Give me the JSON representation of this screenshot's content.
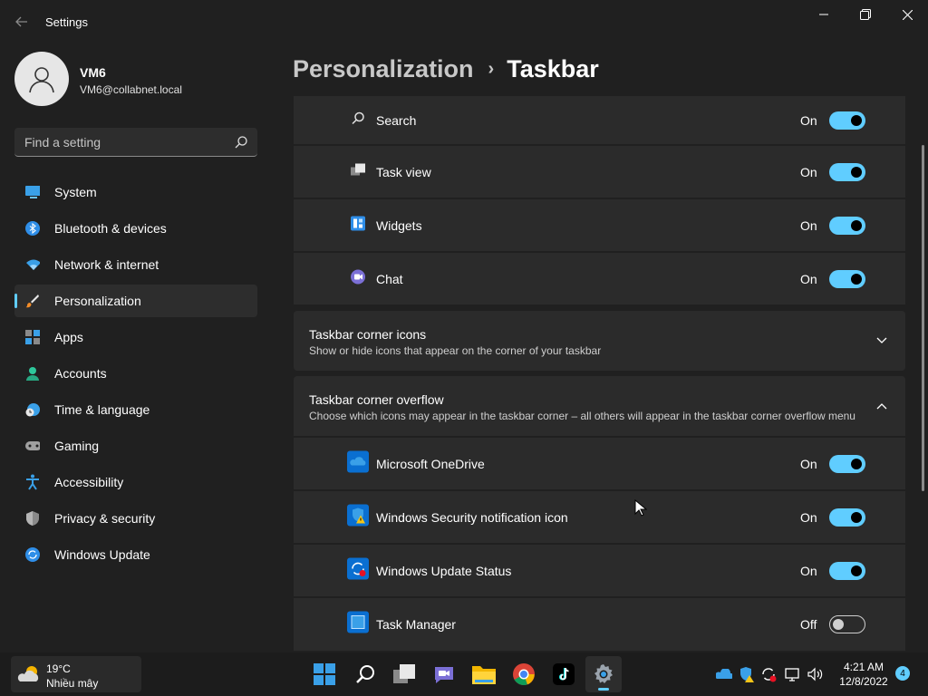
{
  "window": {
    "title": "Settings"
  },
  "user": {
    "name": "VM6",
    "email": "VM6@collabnet.local"
  },
  "search": {
    "placeholder": "Find a setting"
  },
  "sidebar": {
    "items": [
      {
        "label": "System",
        "icon": "monitor-icon"
      },
      {
        "label": "Bluetooth & devices",
        "icon": "bluetooth-icon"
      },
      {
        "label": "Network & internet",
        "icon": "wifi-icon"
      },
      {
        "label": "Personalization",
        "icon": "brush-icon",
        "active": true
      },
      {
        "label": "Apps",
        "icon": "apps-icon"
      },
      {
        "label": "Accounts",
        "icon": "person-icon"
      },
      {
        "label": "Time & language",
        "icon": "clock-globe-icon"
      },
      {
        "label": "Gaming",
        "icon": "gamepad-icon"
      },
      {
        "label": "Accessibility",
        "icon": "accessibility-icon"
      },
      {
        "label": "Privacy & security",
        "icon": "shield-icon"
      },
      {
        "label": "Windows Update",
        "icon": "update-icon"
      }
    ]
  },
  "breadcrumb": {
    "parent": "Personalization",
    "current": "Taskbar"
  },
  "taskbar_items": [
    {
      "label": "Search",
      "state": "On",
      "icon": "search-icon"
    },
    {
      "label": "Task view",
      "state": "On",
      "icon": "task-view-icon"
    },
    {
      "label": "Widgets",
      "state": "On",
      "icon": "widgets-icon"
    },
    {
      "label": "Chat",
      "state": "On",
      "icon": "chat-icon"
    }
  ],
  "corner_icons": {
    "title": "Taskbar corner icons",
    "description": "Show or hide icons that appear on the corner of your taskbar",
    "expanded": false
  },
  "corner_overflow": {
    "title": "Taskbar corner overflow",
    "description": "Choose which icons may appear in the taskbar corner – all others will appear in the taskbar corner overflow menu",
    "expanded": true,
    "items": [
      {
        "label": "Microsoft OneDrive",
        "state": "On",
        "icon": "onedrive-icon"
      },
      {
        "label": "Windows Security notification icon",
        "state": "On",
        "icon": "windows-security-icon"
      },
      {
        "label": "Windows Update Status",
        "state": "On",
        "icon": "windows-update-status-icon"
      },
      {
        "label": "Task Manager",
        "state": "Off",
        "icon": "task-manager-icon"
      }
    ]
  },
  "os_taskbar": {
    "weather": {
      "temp": "19°C",
      "condition": "Nhiều mây"
    },
    "apps": [
      "windows-start-icon",
      "search-icon",
      "task-view-icon",
      "teams-chat-icon",
      "file-explorer-icon",
      "chrome-icon",
      "tiktok-icon",
      "settings-gear-icon"
    ],
    "clock": {
      "time": "4:21 AM",
      "date": "12/8/2022"
    },
    "notifications": "4"
  },
  "colors": {
    "accent": "#60cdff",
    "background": "#202020",
    "card": "#2b2b2b"
  }
}
